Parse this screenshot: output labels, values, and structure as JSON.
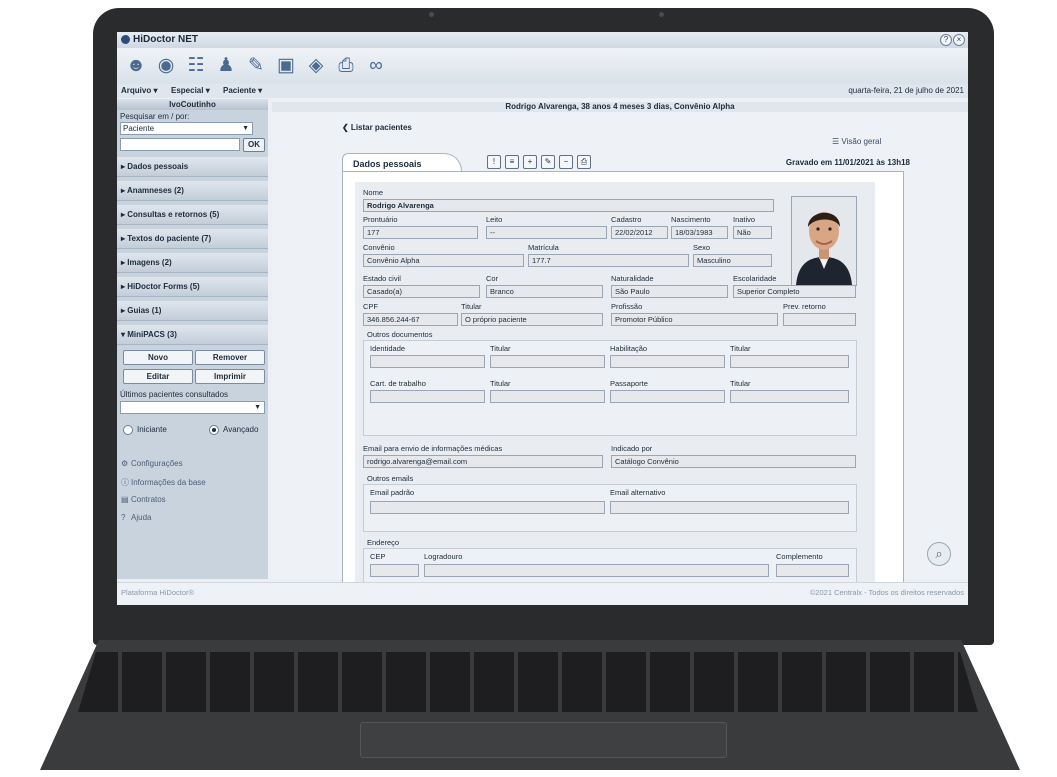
{
  "app": {
    "title": "HiDoctor NET",
    "date": "quarta-feira, 21 de julho de 2021"
  },
  "menu": [
    "Arquivo ▾",
    "Especial ▾",
    "Paciente ▾"
  ],
  "sidebar": {
    "user": "IvoCoutinho",
    "search_label": "Pesquisar em / por:",
    "search_scope": "Paciente",
    "ok": "OK",
    "sections": [
      "▸ Dados pessoais",
      "▸ Anamneses (2)",
      "▸ Consultas e retornos (5)",
      "▸ Textos do paciente (7)",
      "▸ Imagens (2)",
      "▸ HiDoctor Forms (5)",
      "▸ Guias (1)",
      "▾ MiniPACS (3)"
    ],
    "buttons": {
      "novo": "Novo",
      "remover": "Remover",
      "editar": "Editar",
      "imprimir": "Imprimir"
    },
    "recent_label": "Últimos pacientes consultados",
    "mode_iniciante": "Iniciante",
    "mode_avancado": "Avançado",
    "links": [
      "Configurações",
      "Informações da base",
      "Contratos",
      "Ajuda"
    ]
  },
  "main": {
    "patient_bar": "Rodrigo Alvarenga, 38 anos 4 meses 3 dias, Convênio Alpha",
    "back": "❮ Listar pacientes",
    "overview": "☰ Visão geral",
    "tab": "Dados pessoais",
    "saved": "Gravado em 11/01/2021 às 13h18"
  },
  "form": {
    "nome_lbl": "Nome",
    "nome": "Rodrigo Alvarenga",
    "prontuario_lbl": "Prontuário",
    "prontuario": "177",
    "leito_lbl": "Leito",
    "leito": "--",
    "cadastro_lbl": "Cadastro",
    "cadastro": "22/02/2012",
    "nascimento_lbl": "Nascimento",
    "nascimento": "18/03/1983",
    "inativo_lbl": "Inativo",
    "inativo": "Não",
    "convenio_lbl": "Convênio",
    "convenio": "Convênio Alpha",
    "matricula_lbl": "Matrícula",
    "matricula": "177.7",
    "sexo_lbl": "Sexo",
    "sexo": "Masculino",
    "estado_lbl": "Estado civil",
    "estado": "Casado(a)",
    "cor_lbl": "Cor",
    "cor": "Branco",
    "naturalidade_lbl": "Naturalidade",
    "naturalidade": "São Paulo",
    "escolaridade_lbl": "Escolaridade",
    "escolaridade": "Superior Completo",
    "cpf_lbl": "CPF",
    "cpf": "346.856.244-67",
    "titular_lbl": "Titular",
    "titular": "O próprio paciente",
    "profissao_lbl": "Profissão",
    "profissao": "Promotor Público",
    "prev_lbl": "Prev. retorno",
    "outros_docs": "Outros documentos",
    "identidade_lbl": "Identidade",
    "titular2_lbl": "Titular",
    "habilitacao_lbl": "Habilitação",
    "titular3_lbl": "Titular",
    "cart_lbl": "Cart. de trabalho",
    "titular4_lbl": "Titular",
    "passaporte_lbl": "Passaporte",
    "titular5_lbl": "Titular",
    "email_lbl": "Email para envio de informações médicas",
    "email": "rodrigo.alvarenga@email.com",
    "indicado_lbl": "Indicado por",
    "indicado": "Catálogo Convênio",
    "outros_emails": "Outros emails",
    "email_padrao_lbl": "Email padrão",
    "email_alt_lbl": "Email alternativo",
    "endereco": "Endereço",
    "cep_lbl": "CEP",
    "logradouro_lbl": "Logradouro",
    "complemento_lbl": "Complemento"
  },
  "footer": {
    "left": "Plataforma HiDoctor®",
    "right": "©2021 Centralx - Todos os direitos reservados"
  }
}
